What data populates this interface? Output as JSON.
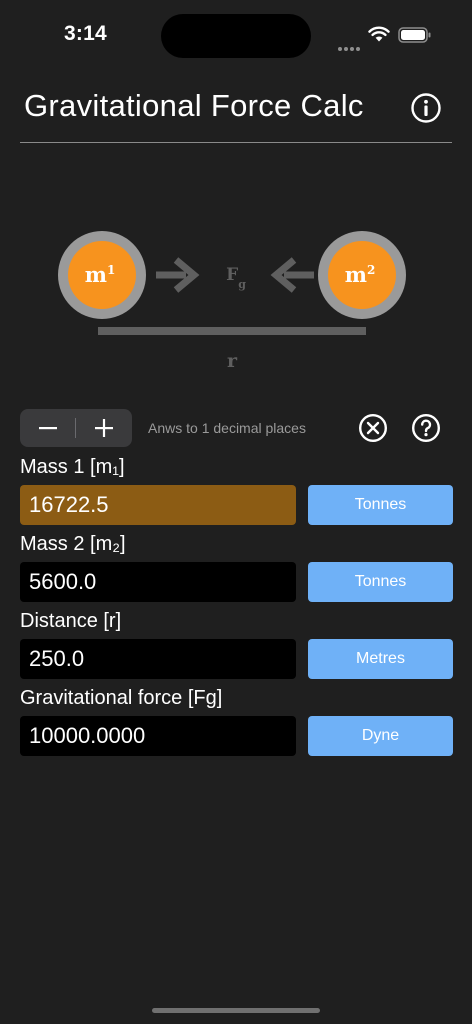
{
  "status_bar": {
    "time": "3:14"
  },
  "header": {
    "title": "Gravitational Force Calc",
    "info_icon": "info-circle-icon"
  },
  "diagram": {
    "mass1_label": "m",
    "mass1_sup": "1",
    "mass2_label": "m",
    "mass2_sup": "2",
    "force_label": "F",
    "force_sub": "g",
    "distance_label": "r",
    "colors": {
      "mass_fill": "#f7931e",
      "mass_ring": "#9a9a9a",
      "arrow": "#5f5f5f"
    }
  },
  "toolbar": {
    "decrease_icon": "minus-icon",
    "increase_icon": "plus-icon",
    "precision_text": "Anws to 1 decimal places",
    "clear_icon": "clear-circle-icon",
    "help_icon": "help-circle-icon"
  },
  "fields": [
    {
      "label": "Mass 1 [m₁]",
      "value": "16722.5",
      "unit": "Tonnes",
      "active": true
    },
    {
      "label": "Mass 2 [m₂]",
      "value": "5600.0",
      "unit": "Tonnes",
      "active": false
    },
    {
      "label": "Distance [r]",
      "value": "250.0",
      "unit": "Metres",
      "active": false
    },
    {
      "label": "Gravitational force [Fg]",
      "value": "10000.0000",
      "unit": "Dyne",
      "active": false
    }
  ],
  "colors": {
    "background": "#1f1f1f",
    "active_field": "#8c5c14",
    "unit_button": "#6fb1f7"
  }
}
